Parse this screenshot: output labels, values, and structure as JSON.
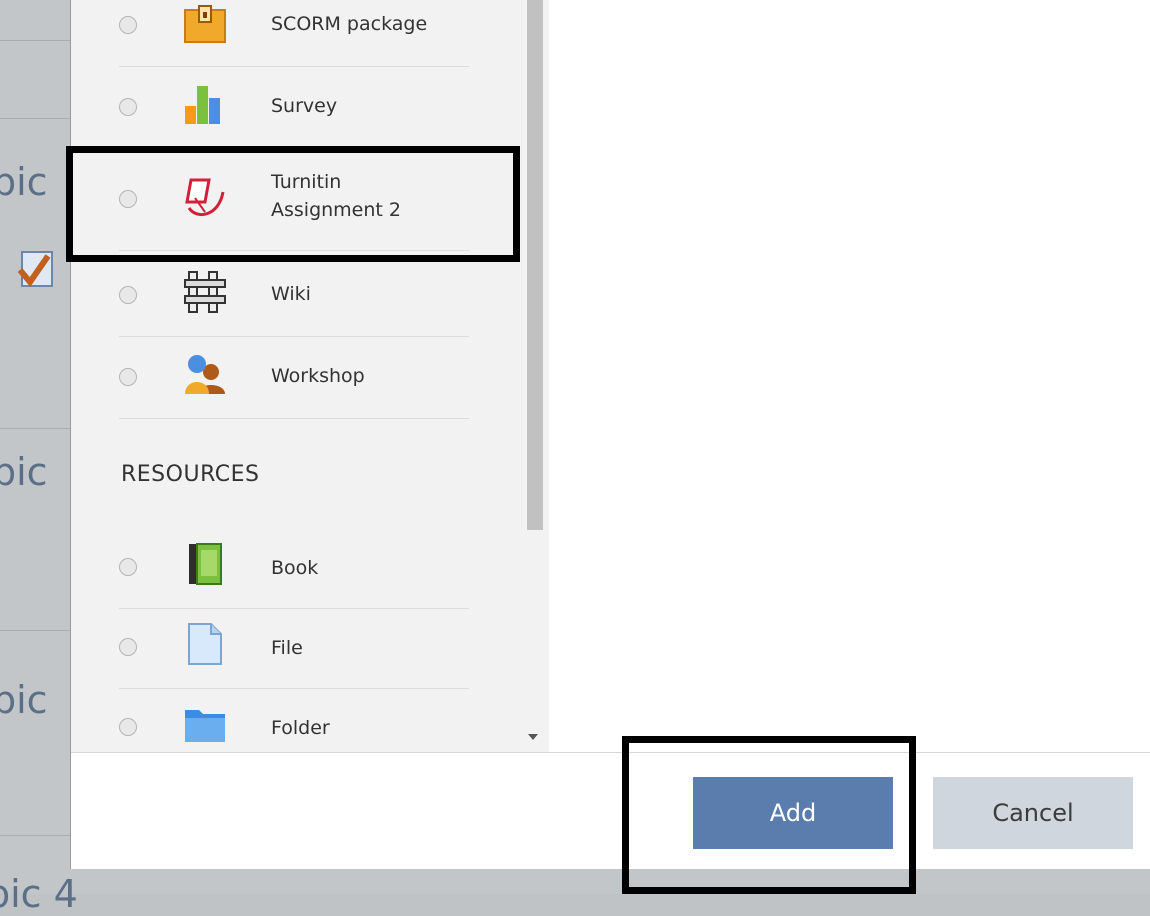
{
  "background": {
    "topic_fragment_1": "pic",
    "topic_fragment_2": "pic",
    "topic_fragment_3": "pic",
    "bottom_fragment": "pic 4"
  },
  "chooser": {
    "activities": [
      {
        "label": "SCORM package",
        "icon": "scorm-package-icon"
      },
      {
        "label": "Survey",
        "icon": "survey-chart-icon"
      },
      {
        "label": "Turnitin\nAssignment 2",
        "icon": "turnitin-icon"
      },
      {
        "label": "Wiki",
        "icon": "wiki-icon"
      },
      {
        "label": "Workshop",
        "icon": "workshop-icon"
      }
    ],
    "resources_heading": "RESOURCES",
    "resources": [
      {
        "label": "Book",
        "icon": "book-icon"
      },
      {
        "label": "File",
        "icon": "file-icon"
      },
      {
        "label": "Folder",
        "icon": "folder-icon"
      }
    ]
  },
  "footer": {
    "add_label": "Add",
    "cancel_label": "Cancel"
  },
  "colors": {
    "primary": "#5b7dae",
    "secondary": "#cfd6de",
    "overlay": "#c3c6c9"
  }
}
